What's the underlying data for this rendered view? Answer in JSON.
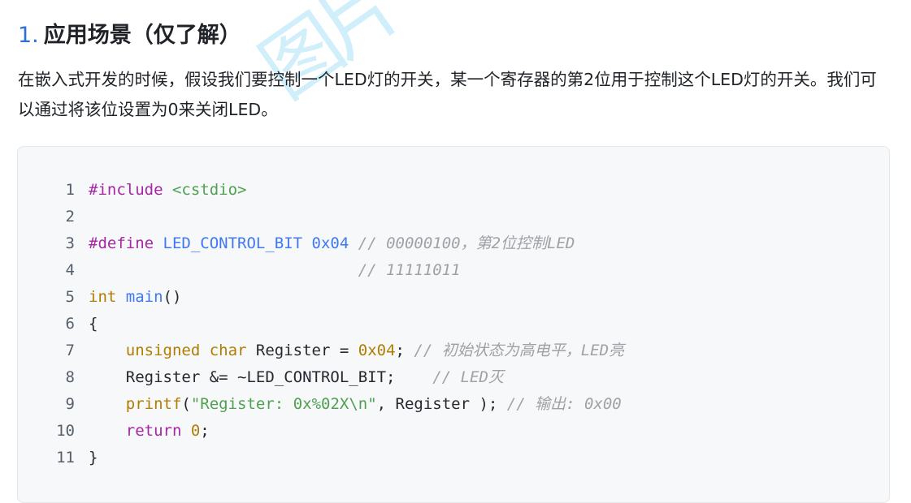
{
  "section": {
    "number": "1.",
    "title": "应用场景（仅了解）"
  },
  "paragraph": "在嵌入式开发的时候，假设我们要控制一个LED灯的开关，某一个寄存器的第2位用于控制这个LED灯的开关。我们可以通过将该位设置为0来关闭LED。",
  "code": {
    "line_numbers": [
      "1",
      "2",
      "3",
      "4",
      "5",
      "6",
      "7",
      "8",
      "9",
      "10",
      "11"
    ],
    "l1_directive": "#include",
    "l1_header": " <cstdio>",
    "l3_directive": "#define",
    "l3_name": " LED_CONTROL_BIT",
    "l3_value": " 0x04",
    "l3_comment": " // 00000100，第2位控制LED",
    "l4_comment": "                             // 11111011",
    "l5_type": "int",
    "l5_func": " main",
    "l5_paren": "()",
    "l6_brace": "{",
    "l7_indent": "    ",
    "l7_type1": "unsigned",
    "l7_type2": " char",
    "l7_text": " Register = ",
    "l7_value": "0x04",
    "l7_semi": ";",
    "l7_comment": " // 初始状态为高电平，LED亮",
    "l8_text": "    Register &= ~LED_CONTROL_BIT;",
    "l8_comment": "    // LED灭",
    "l9_indent": "    ",
    "l9_func": "printf",
    "l9_open": "(",
    "l9_string": "\"Register: 0x%02X\\n\"",
    "l9_rest": ", Register );",
    "l9_comment": " // 输出: 0x00",
    "l10_indent": "    ",
    "l10_keyword": "return",
    "l10_value": " 0",
    "l10_semi": ";",
    "l11_brace": "}"
  },
  "watermark_text": "图片"
}
